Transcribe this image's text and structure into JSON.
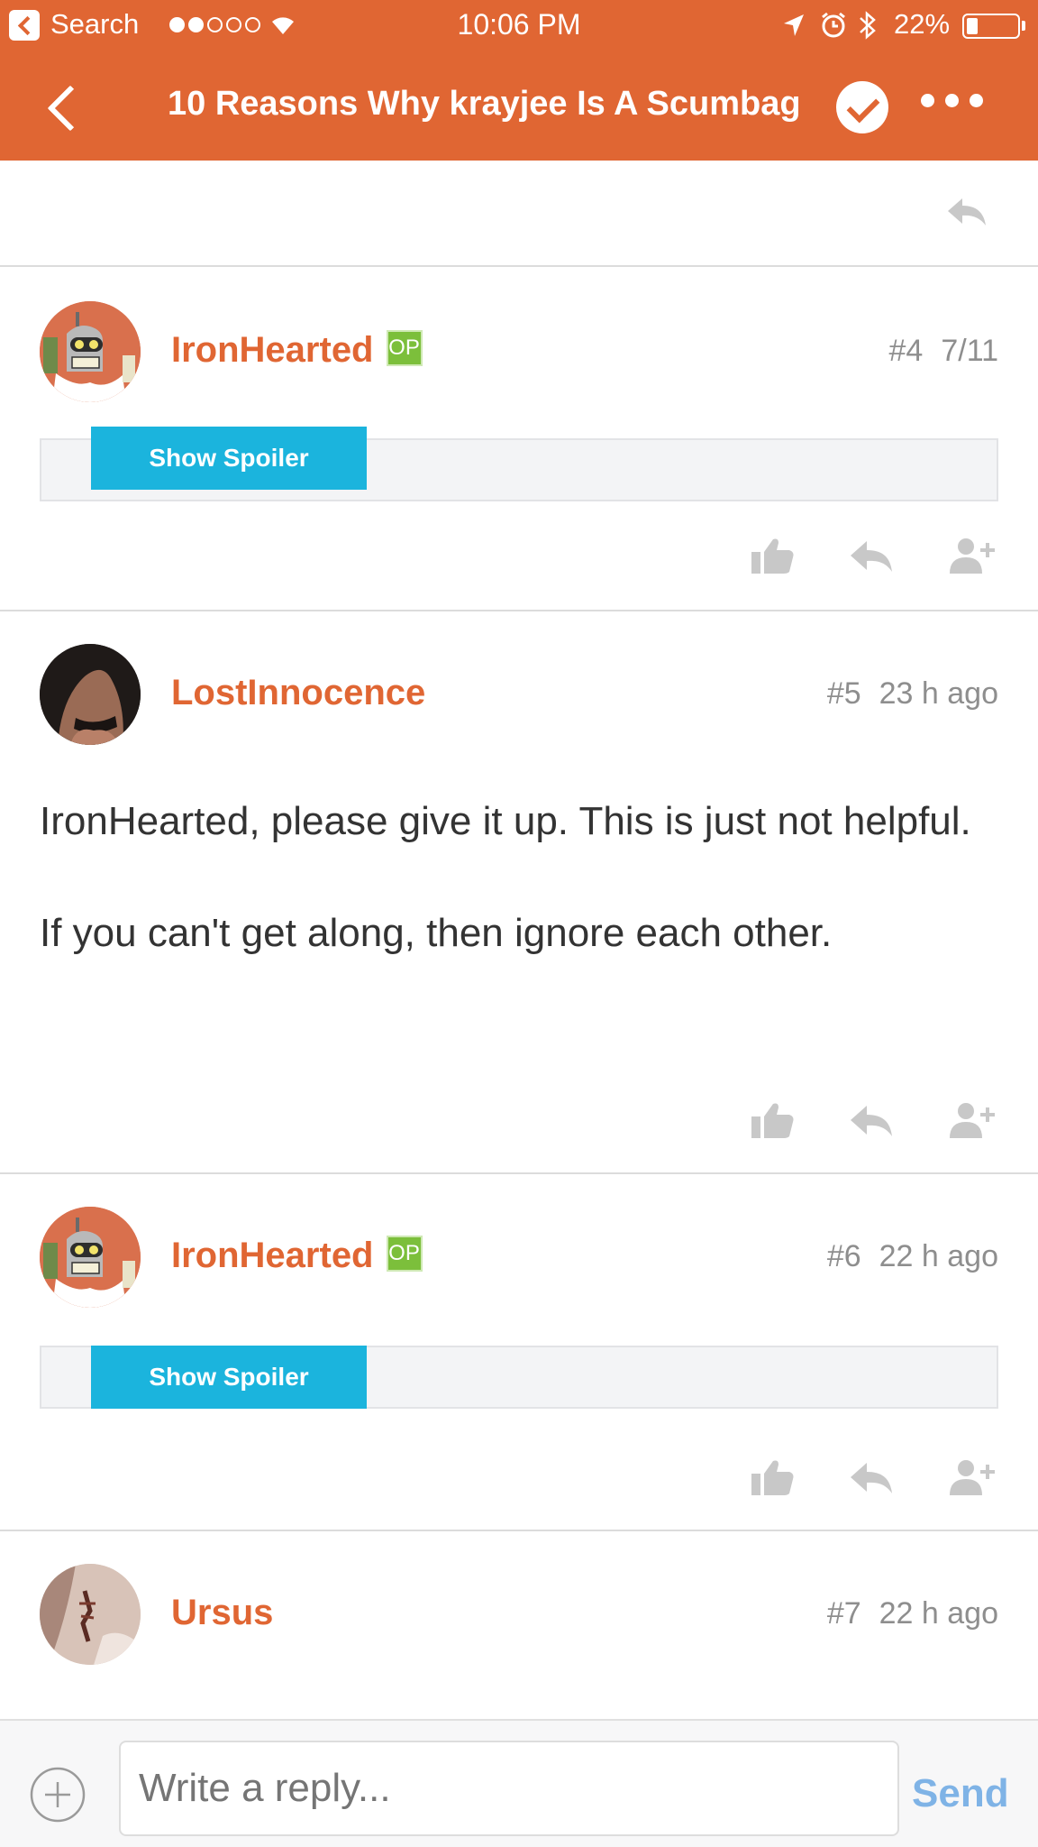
{
  "status_bar": {
    "back_app": "Search",
    "time": "10:06 PM",
    "battery_pct": "22%",
    "battery_level": 0.22
  },
  "nav": {
    "title": "10 Reasons Why krayjee Is A Scumbag"
  },
  "posts": [
    {
      "author": "IronHearted",
      "badge": "OP",
      "number": "#4",
      "time": "7/11",
      "spoiler_label": "Show Spoiler",
      "avatar": "bender-avatar"
    },
    {
      "author": "LostInnocence",
      "number": "#5",
      "time": "23 h ago",
      "paragraphs": [
        "IronHearted, please give it up. This is just not helpful.",
        "If you can't get along, then ignore each other."
      ],
      "avatar": "photo-avatar"
    },
    {
      "author": "IronHearted",
      "badge": "OP",
      "number": "#6",
      "time": "22 h ago",
      "spoiler_label": "Show Spoiler",
      "avatar": "bender-avatar"
    },
    {
      "author": "Ursus",
      "number": "#7",
      "time": "22 h ago",
      "avatar": "photo-avatar"
    }
  ],
  "composer": {
    "placeholder": "Write a reply...",
    "send_label": "Send"
  },
  "colors": {
    "brand": "#e06633",
    "op_badge": "#7cbf3b",
    "spoiler_button": "#1bb4dd",
    "send": "#7fb3e6"
  }
}
